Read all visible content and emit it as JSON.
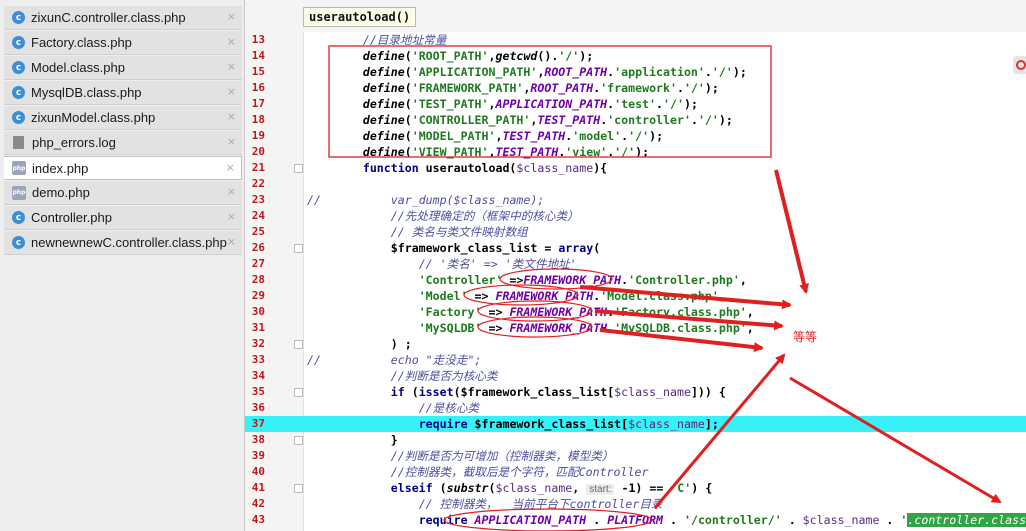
{
  "tabs": [
    {
      "name": "zixunC.controller.class.php",
      "icon": "php-class-icon",
      "active": false
    },
    {
      "name": "Factory.class.php",
      "icon": "php-class-icon",
      "active": false
    },
    {
      "name": "Model.class.php",
      "icon": "php-class-icon",
      "active": false
    },
    {
      "name": "MysqlDB.class.php",
      "icon": "php-class-icon",
      "active": false
    },
    {
      "name": "zixunModel.class.php",
      "icon": "php-class-icon",
      "active": false
    },
    {
      "name": "php_errors.log",
      "icon": "log-file-icon",
      "active": false
    },
    {
      "name": "index.php",
      "icon": "php-file-icon",
      "active": true
    },
    {
      "name": "demo.php",
      "icon": "php-file-icon",
      "active": false
    },
    {
      "name": "Controller.php",
      "icon": "php-class-icon",
      "active": false
    },
    {
      "name": "newnewnewC.controller.class.php",
      "icon": "php-class-icon",
      "active": false
    }
  ],
  "tab_close": "×",
  "breadcrumb": "userautoload()",
  "annotation_note": "等等",
  "highlight_line": 37,
  "colors": {
    "highlight": "#38f0f8",
    "annotation": "#e02020",
    "line_number": "#c01818"
  },
  "code_lines": [
    {
      "n": "13",
      "parts": [
        [
          "",
          "        "
        ],
        [
          "cmt",
          "//目录地址常量"
        ]
      ]
    },
    {
      "n": "14",
      "parts": [
        [
          "",
          "        "
        ],
        [
          "fn",
          "define"
        ],
        [
          "plain",
          "("
        ],
        [
          "str",
          "'ROOT_PATH'"
        ],
        [
          "plain",
          ","
        ],
        [
          "fn",
          "getcwd"
        ],
        [
          "plain",
          "()."
        ],
        [
          "str",
          "'/'"
        ],
        [
          "plain",
          ");"
        ]
      ]
    },
    {
      "n": "15",
      "parts": [
        [
          "",
          "        "
        ],
        [
          "fn",
          "define"
        ],
        [
          "plain",
          "("
        ],
        [
          "str",
          "'APPLICATION_PATH'"
        ],
        [
          "plain",
          ","
        ],
        [
          "const",
          "ROOT_PATH"
        ],
        [
          "plain",
          "."
        ],
        [
          "str",
          "'application'"
        ],
        [
          "plain",
          "."
        ],
        [
          "str",
          "'/'"
        ],
        [
          "plain",
          ");"
        ]
      ]
    },
    {
      "n": "16",
      "parts": [
        [
          "",
          "        "
        ],
        [
          "fn",
          "define"
        ],
        [
          "plain",
          "("
        ],
        [
          "str",
          "'FRAMEWORK_PATH'"
        ],
        [
          "plain",
          ","
        ],
        [
          "const",
          "ROOT_PATH"
        ],
        [
          "plain",
          "."
        ],
        [
          "str",
          "'framework'"
        ],
        [
          "plain",
          "."
        ],
        [
          "str",
          "'/'"
        ],
        [
          "plain",
          ");"
        ]
      ]
    },
    {
      "n": "17",
      "parts": [
        [
          "",
          "        "
        ],
        [
          "fn",
          "define"
        ],
        [
          "plain",
          "("
        ],
        [
          "str",
          "'TEST_PATH'"
        ],
        [
          "plain",
          ","
        ],
        [
          "const",
          "APPLICATION_PATH"
        ],
        [
          "plain",
          "."
        ],
        [
          "str",
          "'test'"
        ],
        [
          "plain",
          "."
        ],
        [
          "str",
          "'/'"
        ],
        [
          "plain",
          ");"
        ]
      ]
    },
    {
      "n": "18",
      "parts": [
        [
          "",
          "        "
        ],
        [
          "fn",
          "define"
        ],
        [
          "plain",
          "("
        ],
        [
          "str",
          "'CONTROLLER_PATH'"
        ],
        [
          "plain",
          ","
        ],
        [
          "const",
          "TEST_PATH"
        ],
        [
          "plain",
          "."
        ],
        [
          "str",
          "'controller'"
        ],
        [
          "plain",
          "."
        ],
        [
          "str",
          "'/'"
        ],
        [
          "plain",
          ");"
        ]
      ]
    },
    {
      "n": "19",
      "parts": [
        [
          "",
          "        "
        ],
        [
          "fn",
          "define"
        ],
        [
          "plain",
          "("
        ],
        [
          "str",
          "'MODEL_PATH'"
        ],
        [
          "plain",
          ","
        ],
        [
          "const",
          "TEST_PATH"
        ],
        [
          "plain",
          "."
        ],
        [
          "str",
          "'model'"
        ],
        [
          "plain",
          "."
        ],
        [
          "str",
          "'/'"
        ],
        [
          "plain",
          ");"
        ]
      ]
    },
    {
      "n": "20",
      "parts": [
        [
          "",
          "        "
        ],
        [
          "fn",
          "define"
        ],
        [
          "plain",
          "("
        ],
        [
          "str",
          "'VIEW_PATH'"
        ],
        [
          "plain",
          ","
        ],
        [
          "const",
          "TEST_PATH"
        ],
        [
          "plain",
          "."
        ],
        [
          "str",
          "'view'"
        ],
        [
          "plain",
          "."
        ],
        [
          "str",
          "'/'"
        ],
        [
          "plain",
          ");"
        ]
      ]
    },
    {
      "n": "21",
      "parts": [
        [
          "",
          "        "
        ],
        [
          "kw",
          "function"
        ],
        [
          "plain",
          " userautoload("
        ],
        [
          "var",
          "$class_name"
        ],
        [
          "plain",
          "){"
        ]
      ]
    },
    {
      "n": "22",
      "parts": []
    },
    {
      "n": "23",
      "parts": [
        [
          "cmt",
          "//"
        ],
        [
          "",
          "          "
        ],
        [
          "cmt",
          "var_dump("
        ],
        [
          "cmt",
          "$class_name"
        ],
        [
          "cmt",
          ");"
        ]
      ]
    },
    {
      "n": "24",
      "parts": [
        [
          "",
          "            "
        ],
        [
          "cmt",
          "//先处理确定的（框架中的核心类）"
        ]
      ]
    },
    {
      "n": "25",
      "parts": [
        [
          "",
          "            "
        ],
        [
          "cmt",
          "// 类名与类文件映射数组"
        ]
      ]
    },
    {
      "n": "26",
      "parts": [
        [
          "",
          "            "
        ],
        [
          "plain",
          "$framework_class_list"
        ],
        [
          "plain",
          " = "
        ],
        [
          "kw",
          "array"
        ],
        [
          "plain",
          "("
        ]
      ]
    },
    {
      "n": "27",
      "parts": [
        [
          "",
          "                "
        ],
        [
          "cmt",
          "// '类名' => '类文件地址'"
        ]
      ]
    },
    {
      "n": "28",
      "parts": [
        [
          "",
          "                "
        ],
        [
          "str",
          "'Controller'"
        ],
        [
          "plain",
          " =>"
        ],
        [
          "const",
          "FRAMEWORK_PATH"
        ],
        [
          "plain",
          "."
        ],
        [
          "str",
          "'Controller.php'"
        ],
        [
          "plain",
          ","
        ]
      ]
    },
    {
      "n": "29",
      "parts": [
        [
          "",
          "                "
        ],
        [
          "str",
          "'Model'"
        ],
        [
          "plain",
          " => "
        ],
        [
          "const",
          "FRAMEWORK_PATH"
        ],
        [
          "plain",
          "."
        ],
        [
          "str",
          "'Model.class.php'"
        ],
        [
          "plain",
          ","
        ]
      ]
    },
    {
      "n": "30",
      "parts": [
        [
          "",
          "                "
        ],
        [
          "str",
          "'Factory'"
        ],
        [
          "plain",
          " => "
        ],
        [
          "const",
          "FRAMEWORK_PATH"
        ],
        [
          "plain",
          "."
        ],
        [
          "str",
          "'Factory.class.php'"
        ],
        [
          "plain",
          ","
        ]
      ]
    },
    {
      "n": "31",
      "parts": [
        [
          "",
          "                "
        ],
        [
          "str",
          "'MySQLDB'"
        ],
        [
          "plain",
          " => "
        ],
        [
          "const",
          "FRAMEWORK_PATH"
        ],
        [
          "plain",
          "."
        ],
        [
          "str",
          "'MySQLDB.class.php'"
        ],
        [
          "plain",
          ","
        ]
      ]
    },
    {
      "n": "32",
      "parts": [
        [
          "",
          "            "
        ],
        [
          "plain",
          ") ;"
        ]
      ]
    },
    {
      "n": "33",
      "parts": [
        [
          "cmt",
          "//"
        ],
        [
          "",
          "          "
        ],
        [
          "cmt",
          "echo \"走没走\";"
        ]
      ]
    },
    {
      "n": "34",
      "parts": [
        [
          "",
          "            "
        ],
        [
          "cmt",
          "//判断是否为核心类"
        ]
      ]
    },
    {
      "n": "35",
      "parts": [
        [
          "",
          "            "
        ],
        [
          "kw",
          "if"
        ],
        [
          "plain",
          " ("
        ],
        [
          "kw",
          "isset"
        ],
        [
          "plain",
          "("
        ],
        [
          "plain",
          "$framework_class_list"
        ],
        [
          "plain",
          "["
        ],
        [
          "var",
          "$class_name"
        ],
        [
          "plain",
          "])) {"
        ]
      ]
    },
    {
      "n": "36",
      "parts": [
        [
          "",
          "                "
        ],
        [
          "cmt",
          "//是核心类"
        ]
      ]
    },
    {
      "n": "37",
      "parts": [
        [
          "",
          "                "
        ],
        [
          "kw",
          "require"
        ],
        [
          "plain",
          " $framework_class_list["
        ],
        [
          "var",
          "$class_name"
        ],
        [
          "plain",
          "];"
        ]
      ]
    },
    {
      "n": "38",
      "parts": [
        [
          "",
          "            "
        ],
        [
          "plain",
          "}"
        ]
      ]
    },
    {
      "n": "39",
      "parts": [
        [
          "",
          "            "
        ],
        [
          "cmt",
          "//判断是否为可增加（控制器类，模型类）"
        ]
      ]
    },
    {
      "n": "40",
      "parts": [
        [
          "",
          "            "
        ],
        [
          "cmt",
          "//控制器类，截取后是个字符，匹配Controller"
        ]
      ]
    },
    {
      "n": "41",
      "parts": [
        [
          "",
          "            "
        ],
        [
          "kw",
          "elseif"
        ],
        [
          "plain",
          " ("
        ],
        [
          "fn",
          "substr"
        ],
        [
          "plain",
          "("
        ],
        [
          "var",
          "$class_name"
        ],
        [
          "plain",
          ", "
        ],
        [
          "hint",
          "start:"
        ],
        [
          "plain",
          " -1) == "
        ],
        [
          "str",
          "'C'"
        ],
        [
          "plain",
          ") {"
        ]
      ]
    },
    {
      "n": "42",
      "parts": [
        [
          "",
          "                "
        ],
        [
          "cmt",
          "// 控制器类，  当前平台下controller目录"
        ]
      ]
    },
    {
      "n": "43",
      "parts": [
        [
          "",
          "                "
        ],
        [
          "kw",
          "require"
        ],
        [
          "plain",
          " "
        ],
        [
          "const",
          "APPLICATION_PATH"
        ],
        [
          "plain",
          " . "
        ],
        [
          "const",
          "PLATFORM"
        ],
        [
          "plain",
          " . "
        ],
        [
          "str",
          "'/controller/'"
        ],
        [
          "plain",
          " . "
        ],
        [
          "var",
          "$class_name"
        ],
        [
          "plain",
          " . "
        ],
        [
          "str",
          "'"
        ],
        [
          "bar-str",
          ".controller.class.php"
        ]
      ]
    }
  ]
}
